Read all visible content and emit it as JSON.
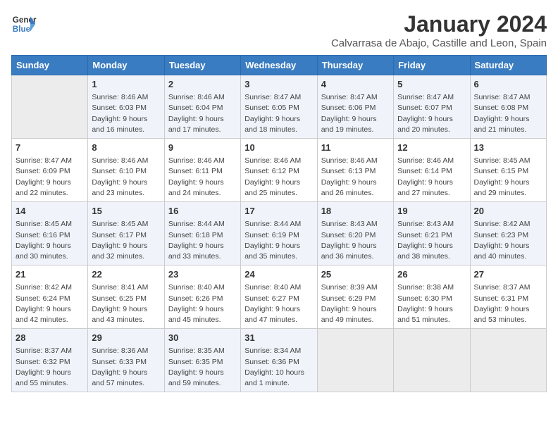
{
  "logo": {
    "line1": "General",
    "line2": "Blue"
  },
  "title": "January 2024",
  "subtitle": "Calvarrasa de Abajo, Castille and Leon, Spain",
  "days_of_week": [
    "Sunday",
    "Monday",
    "Tuesday",
    "Wednesday",
    "Thursday",
    "Friday",
    "Saturday"
  ],
  "weeks": [
    [
      {
        "num": "",
        "empty": true
      },
      {
        "num": "1",
        "sunrise": "Sunrise: 8:46 AM",
        "sunset": "Sunset: 6:03 PM",
        "daylight": "Daylight: 9 hours and 16 minutes."
      },
      {
        "num": "2",
        "sunrise": "Sunrise: 8:46 AM",
        "sunset": "Sunset: 6:04 PM",
        "daylight": "Daylight: 9 hours and 17 minutes."
      },
      {
        "num": "3",
        "sunrise": "Sunrise: 8:47 AM",
        "sunset": "Sunset: 6:05 PM",
        "daylight": "Daylight: 9 hours and 18 minutes."
      },
      {
        "num": "4",
        "sunrise": "Sunrise: 8:47 AM",
        "sunset": "Sunset: 6:06 PM",
        "daylight": "Daylight: 9 hours and 19 minutes."
      },
      {
        "num": "5",
        "sunrise": "Sunrise: 8:47 AM",
        "sunset": "Sunset: 6:07 PM",
        "daylight": "Daylight: 9 hours and 20 minutes."
      },
      {
        "num": "6",
        "sunrise": "Sunrise: 8:47 AM",
        "sunset": "Sunset: 6:08 PM",
        "daylight": "Daylight: 9 hours and 21 minutes."
      }
    ],
    [
      {
        "num": "7",
        "sunrise": "Sunrise: 8:47 AM",
        "sunset": "Sunset: 6:09 PM",
        "daylight": "Daylight: 9 hours and 22 minutes."
      },
      {
        "num": "8",
        "sunrise": "Sunrise: 8:46 AM",
        "sunset": "Sunset: 6:10 PM",
        "daylight": "Daylight: 9 hours and 23 minutes."
      },
      {
        "num": "9",
        "sunrise": "Sunrise: 8:46 AM",
        "sunset": "Sunset: 6:11 PM",
        "daylight": "Daylight: 9 hours and 24 minutes."
      },
      {
        "num": "10",
        "sunrise": "Sunrise: 8:46 AM",
        "sunset": "Sunset: 6:12 PM",
        "daylight": "Daylight: 9 hours and 25 minutes."
      },
      {
        "num": "11",
        "sunrise": "Sunrise: 8:46 AM",
        "sunset": "Sunset: 6:13 PM",
        "daylight": "Daylight: 9 hours and 26 minutes."
      },
      {
        "num": "12",
        "sunrise": "Sunrise: 8:46 AM",
        "sunset": "Sunset: 6:14 PM",
        "daylight": "Daylight: 9 hours and 27 minutes."
      },
      {
        "num": "13",
        "sunrise": "Sunrise: 8:45 AM",
        "sunset": "Sunset: 6:15 PM",
        "daylight": "Daylight: 9 hours and 29 minutes."
      }
    ],
    [
      {
        "num": "14",
        "sunrise": "Sunrise: 8:45 AM",
        "sunset": "Sunset: 6:16 PM",
        "daylight": "Daylight: 9 hours and 30 minutes."
      },
      {
        "num": "15",
        "sunrise": "Sunrise: 8:45 AM",
        "sunset": "Sunset: 6:17 PM",
        "daylight": "Daylight: 9 hours and 32 minutes."
      },
      {
        "num": "16",
        "sunrise": "Sunrise: 8:44 AM",
        "sunset": "Sunset: 6:18 PM",
        "daylight": "Daylight: 9 hours and 33 minutes."
      },
      {
        "num": "17",
        "sunrise": "Sunrise: 8:44 AM",
        "sunset": "Sunset: 6:19 PM",
        "daylight": "Daylight: 9 hours and 35 minutes."
      },
      {
        "num": "18",
        "sunrise": "Sunrise: 8:43 AM",
        "sunset": "Sunset: 6:20 PM",
        "daylight": "Daylight: 9 hours and 36 minutes."
      },
      {
        "num": "19",
        "sunrise": "Sunrise: 8:43 AM",
        "sunset": "Sunset: 6:21 PM",
        "daylight": "Daylight: 9 hours and 38 minutes."
      },
      {
        "num": "20",
        "sunrise": "Sunrise: 8:42 AM",
        "sunset": "Sunset: 6:23 PM",
        "daylight": "Daylight: 9 hours and 40 minutes."
      }
    ],
    [
      {
        "num": "21",
        "sunrise": "Sunrise: 8:42 AM",
        "sunset": "Sunset: 6:24 PM",
        "daylight": "Daylight: 9 hours and 42 minutes."
      },
      {
        "num": "22",
        "sunrise": "Sunrise: 8:41 AM",
        "sunset": "Sunset: 6:25 PM",
        "daylight": "Daylight: 9 hours and 43 minutes."
      },
      {
        "num": "23",
        "sunrise": "Sunrise: 8:40 AM",
        "sunset": "Sunset: 6:26 PM",
        "daylight": "Daylight: 9 hours and 45 minutes."
      },
      {
        "num": "24",
        "sunrise": "Sunrise: 8:40 AM",
        "sunset": "Sunset: 6:27 PM",
        "daylight": "Daylight: 9 hours and 47 minutes."
      },
      {
        "num": "25",
        "sunrise": "Sunrise: 8:39 AM",
        "sunset": "Sunset: 6:29 PM",
        "daylight": "Daylight: 9 hours and 49 minutes."
      },
      {
        "num": "26",
        "sunrise": "Sunrise: 8:38 AM",
        "sunset": "Sunset: 6:30 PM",
        "daylight": "Daylight: 9 hours and 51 minutes."
      },
      {
        "num": "27",
        "sunrise": "Sunrise: 8:37 AM",
        "sunset": "Sunset: 6:31 PM",
        "daylight": "Daylight: 9 hours and 53 minutes."
      }
    ],
    [
      {
        "num": "28",
        "sunrise": "Sunrise: 8:37 AM",
        "sunset": "Sunset: 6:32 PM",
        "daylight": "Daylight: 9 hours and 55 minutes."
      },
      {
        "num": "29",
        "sunrise": "Sunrise: 8:36 AM",
        "sunset": "Sunset: 6:33 PM",
        "daylight": "Daylight: 9 hours and 57 minutes."
      },
      {
        "num": "30",
        "sunrise": "Sunrise: 8:35 AM",
        "sunset": "Sunset: 6:35 PM",
        "daylight": "Daylight: 9 hours and 59 minutes."
      },
      {
        "num": "31",
        "sunrise": "Sunrise: 8:34 AM",
        "sunset": "Sunset: 6:36 PM",
        "daylight": "Daylight: 10 hours and 1 minute."
      },
      {
        "num": "",
        "empty": true
      },
      {
        "num": "",
        "empty": true
      },
      {
        "num": "",
        "empty": true
      }
    ]
  ]
}
